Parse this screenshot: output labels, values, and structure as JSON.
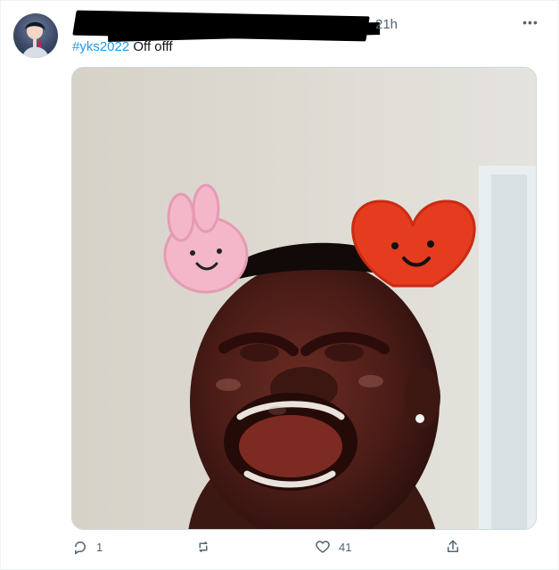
{
  "tweet": {
    "timestamp": "21h",
    "hashtag": "#yks2022",
    "text_rest": " Off offf",
    "actions": {
      "reply_count": "1",
      "retweet_count": "",
      "like_count": "41"
    }
  },
  "icons": {
    "more": "more-icon",
    "reply": "reply-icon",
    "retweet": "retweet-icon",
    "like": "heart-icon",
    "share": "share-icon"
  }
}
